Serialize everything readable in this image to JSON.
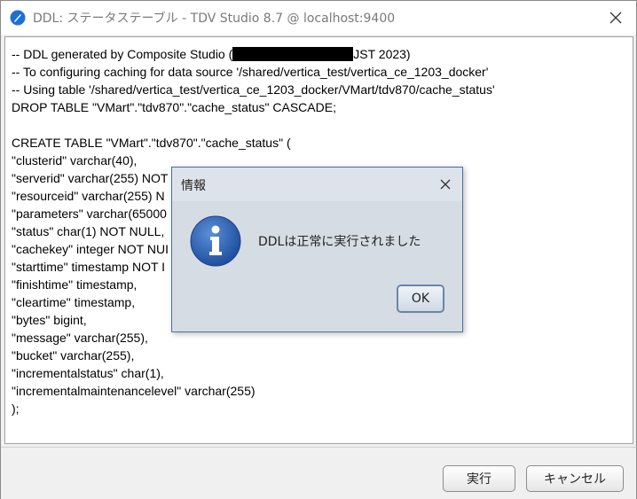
{
  "window": {
    "title": "DDL: ステータステーブル - TDV Studio 8.7 @ localhost:9400",
    "icon": "tdv-app-icon",
    "close_icon": "close-icon"
  },
  "ddl": {
    "lines": [
      "-- DDL generated by Composite Studio (",
      "JST 2023)",
      "-- To configuring caching for data source '/shared/vertica_test/vertica_ce_1203_docker'",
      "-- Using table '/shared/vertica_test/vertica_ce_1203_docker/VMart/tdv870/cache_status'",
      "DROP TABLE \"VMart\".\"tdv870\".\"cache_status\" CASCADE;",
      "",
      "CREATE TABLE \"VMart\".\"tdv870\".\"cache_status\" (",
      "\"clusterid\" varchar(40),",
      "\"serverid\" varchar(255) NOT",
      "\"resourceid\" varchar(255) N",
      "\"parameters\" varchar(65000",
      "\"status\" char(1) NOT NULL,",
      "\"cachekey\" integer NOT NUI",
      "\"starttime\" timestamp NOT I",
      "\"finishtime\" timestamp,",
      "\"cleartime\" timestamp,",
      "\"bytes\" bigint,",
      "\"message\" varchar(255),",
      "\"bucket\" varchar(255),",
      "\"incrementalstatus\" char(1),",
      "\"incrementalmaintenancelevel\" varchar(255)",
      ");"
    ]
  },
  "footer": {
    "run_label": "実行",
    "cancel_label": "キャンセル"
  },
  "dialog": {
    "title": "情報",
    "message": "DDLは正常に実行されました",
    "ok_label": "OK",
    "icon": "info-icon"
  },
  "colors": {
    "dialog_border": "#4a6fa0",
    "info_icon": "#2f62b4"
  }
}
